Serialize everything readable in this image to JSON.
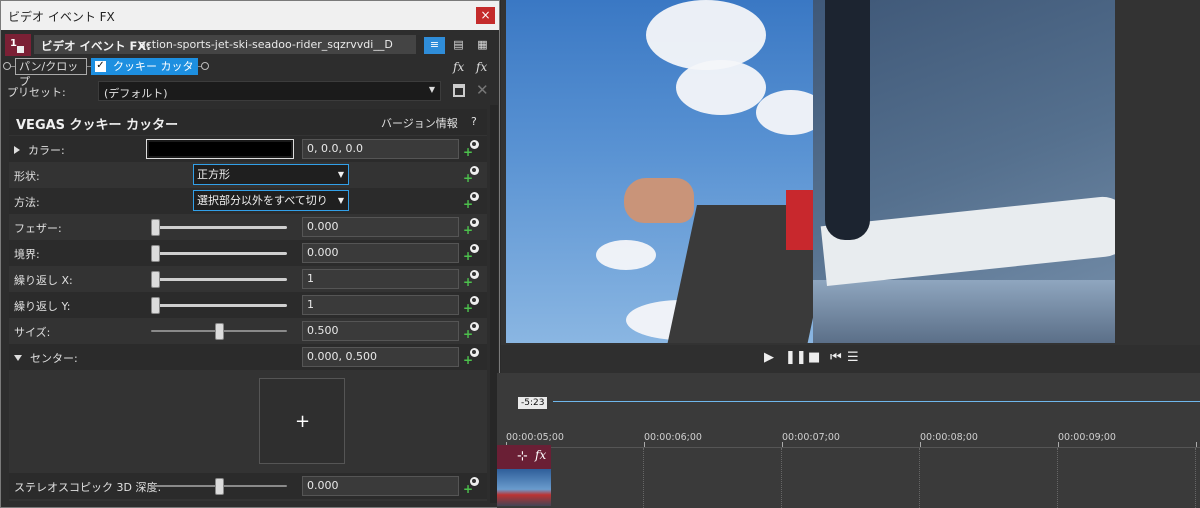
{
  "window": {
    "title": "ビデオ イベント FX",
    "close": "×"
  },
  "chain": {
    "index": "1",
    "label": "ビデオ イベント FX:",
    "name": "action-sports-jet-ski-seadoo-rider_sqzrvvdi__D",
    "view_buttons": [
      "≡",
      "▤",
      "▦"
    ]
  },
  "plugins": {
    "pan_crop": "パン/クロップ",
    "cookie_cutter": "クッキー カッター",
    "cookie_checked": "✓",
    "fx_icon": "fx"
  },
  "preset": {
    "label": "プリセット:",
    "value": "(デフォルト)"
  },
  "panel": {
    "title": "VEGAS クッキー カッター",
    "version_link": "バージョン情報",
    "help": "?",
    "params": {
      "color": {
        "label": "カラー:",
        "value": "0, 0.0, 0.0"
      },
      "shape": {
        "label": "形状:",
        "value": "正方形"
      },
      "method": {
        "label": "方法:",
        "value": "選択部分以外をすべて切り"
      },
      "feather": {
        "label": "フェザー:",
        "value": "0.000",
        "level": 0
      },
      "border": {
        "label": "境界:",
        "value": "0.000",
        "level": 0
      },
      "repeat_x": {
        "label": "繰り返し X:",
        "value": "1",
        "level": 0
      },
      "repeat_y": {
        "label": "繰り返し Y:",
        "value": "1",
        "level": 0
      },
      "size": {
        "label": "サイズ:",
        "value": "0.500",
        "level": 0.5
      },
      "center": {
        "label": "センター:",
        "value": "0.000, 0.500"
      },
      "stereo": {
        "label": "ステレオスコピック 3D 深度:",
        "value": "0.000",
        "level": 0.5
      }
    }
  },
  "timeline": {
    "cursor_time": "-5:23",
    "ruler": [
      "00:00:05;00",
      "00:00:06;00",
      "00:00:07;00",
      "00:00:08;00",
      "00:00:09;00"
    ]
  },
  "icons": {
    "save": "save-icon",
    "delete": "close-icon",
    "play": "play-icon",
    "pause": "pause-icon",
    "stop": "stop-icon",
    "prev": "prev-frame-icon",
    "list": "list-icon",
    "crop": "crop-icon"
  },
  "colors": {
    "accent": "#1d8fe0",
    "event_header": "#6a1f35"
  }
}
